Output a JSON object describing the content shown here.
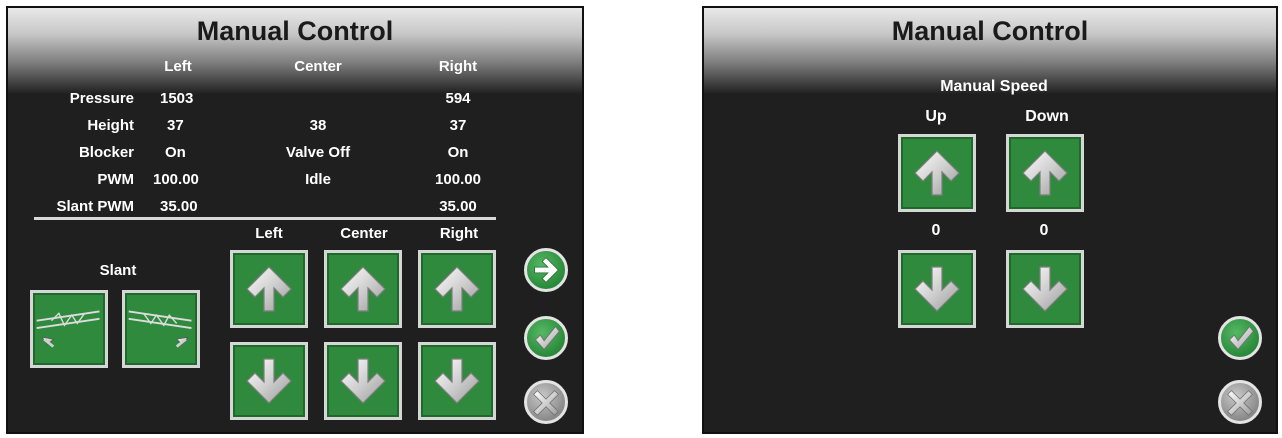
{
  "left_panel": {
    "title": "Manual Control",
    "columns": [
      "Left",
      "Center",
      "Right"
    ],
    "rows": [
      {
        "label": "Pressure",
        "left": "1503",
        "center": "",
        "right": "594"
      },
      {
        "label": "Height",
        "left": "37",
        "center": "38",
        "right": "37"
      },
      {
        "label": "Blocker",
        "left": "On",
        "center": "Valve Off",
        "right": "On"
      },
      {
        "label": "PWM",
        "left": "100.00",
        "center": "Idle",
        "right": "100.00"
      },
      {
        "label": "Slant PWM",
        "left": "35.00",
        "center": "",
        "right": "35.00"
      }
    ],
    "slant_label": "Slant",
    "control_columns": [
      "Left",
      "Center",
      "Right"
    ],
    "icons": {
      "up": "arrow-up-icon",
      "down": "arrow-down-icon",
      "next": "arrow-right-icon",
      "accept": "checkmark-icon",
      "cancel": "close-icon"
    }
  },
  "right_panel": {
    "title": "Manual Speed",
    "header_title": "Manual Control",
    "columns": [
      "Up",
      "Down"
    ],
    "values": [
      "0",
      "0"
    ]
  },
  "colors": {
    "button_green": "#2f8a3e",
    "background": "#1f1f1f",
    "cancel_grey": "#9a9a9a"
  }
}
